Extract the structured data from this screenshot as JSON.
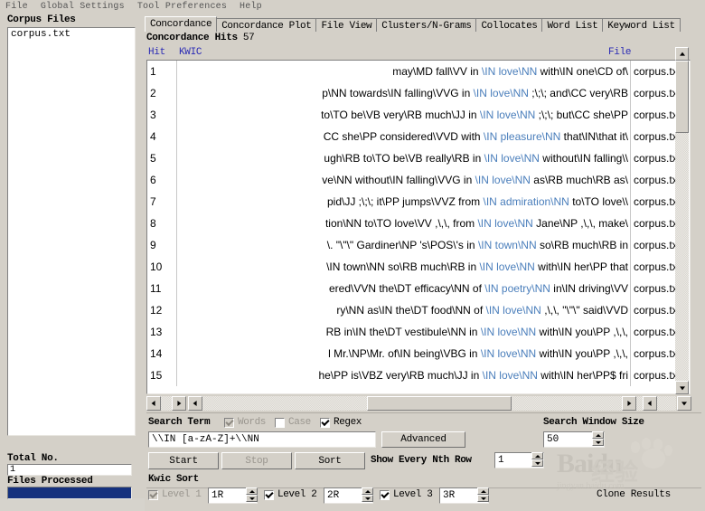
{
  "menubar": {
    "items": [
      {
        "label": "File"
      },
      {
        "label": "Global Settings"
      },
      {
        "label": "Tool Preferences"
      },
      {
        "label": "Help"
      }
    ]
  },
  "sidebar": {
    "corpus_files_label": "Corpus Files",
    "files": [
      "corpus.txt"
    ],
    "total_no_label": "Total No.",
    "total_no_value": "1",
    "files_processed_label": "Files Processed"
  },
  "tabs": [
    {
      "label": "Concordance",
      "active": true
    },
    {
      "label": "Concordance Plot",
      "active": false
    },
    {
      "label": "File View",
      "active": false
    },
    {
      "label": "Clusters/N-Grams",
      "active": false
    },
    {
      "label": "Collocates",
      "active": false
    },
    {
      "label": "Word List",
      "active": false
    },
    {
      "label": "Keyword List",
      "active": false
    }
  ],
  "results": {
    "hits_label": "Concordance Hits",
    "hits_count": "57",
    "columns": {
      "hit": "Hit",
      "kwic": "KWIC",
      "file": "File"
    },
    "rows": [
      {
        "n": "1",
        "left": "may\\MD fall\\VV in",
        "key": "\\IN love\\NN",
        "right": "with\\IN one\\CD of\\",
        "file": "corpus.txt"
      },
      {
        "n": "2",
        "left": "p\\NN towards\\IN falling\\VVG in",
        "key": "\\IN love\\NN",
        "right": ";\\;\\; and\\CC very\\RB",
        "file": "corpus.txt"
      },
      {
        "n": "3",
        "left": "to\\TO be\\VB very\\RB much\\JJ in",
        "key": "\\IN love\\NN",
        "right": ";\\;\\; but\\CC she\\PP ",
        "file": "corpus.txt"
      },
      {
        "n": "4",
        "left": "CC she\\PP considered\\VVD with",
        "key": "\\IN pleasure\\NN",
        "right": "that\\IN\\that it\\",
        "file": "corpus.txt"
      },
      {
        "n": "5",
        "left": "ugh\\RB to\\TO be\\VB really\\RB in",
        "key": "\\IN love\\NN",
        "right": "without\\IN falling\\\\",
        "file": "corpus.txt"
      },
      {
        "n": "6",
        "left": "ve\\NN without\\IN falling\\VVG in",
        "key": "\\IN love\\NN",
        "right": "as\\RB much\\RB as\\",
        "file": "corpus.txt"
      },
      {
        "n": "7",
        "left": "pid\\JJ ;\\;\\; it\\PP jumps\\VVZ from",
        "key": "\\IN admiration\\NN",
        "right": "to\\TO love\\\\",
        "file": "corpus.txt"
      },
      {
        "n": "8",
        "left": "tion\\NN to\\TO love\\VV ,\\,\\, from",
        "key": "\\IN love\\NN",
        "right": "Jane\\NP ,\\,\\, make\\",
        "file": "corpus.txt"
      },
      {
        "n": "9",
        "left": "\\. \"\\\"\\\" Gardiner\\NP 's\\POS\\'s in",
        "key": "\\IN town\\NN",
        "right": "so\\RB much\\RB in",
        "file": "corpus.txt"
      },
      {
        "n": "10",
        "left": "\\IN town\\NN so\\RB much\\RB in",
        "key": "\\IN love\\NN",
        "right": "with\\IN her\\PP that",
        "file": "corpus.txt"
      },
      {
        "n": "11",
        "left": "ered\\VVN the\\DT efficacy\\NN of",
        "key": "\\IN poetry\\NN",
        "right": "in\\IN driving\\VV",
        "file": "corpus.txt"
      },
      {
        "n": "12",
        "left": "ry\\NN as\\IN the\\DT food\\NN of",
        "key": "\\IN love\\NN",
        "right": ",\\,\\, \"\\\"\\\" said\\VVD ",
        "file": "corpus.txt"
      },
      {
        "n": "13",
        "left": "RB in\\IN the\\DT vestibule\\NN in",
        "key": "\\IN love\\NN",
        "right": "with\\IN you\\PP ,\\,\\,",
        "file": "corpus.txt"
      },
      {
        "n": "14",
        "left": "l Mr.\\NP\\Mr. of\\IN being\\VBG in",
        "key": "\\IN love\\NN",
        "right": "with\\IN you\\PP ,\\,\\,",
        "file": "corpus.txt"
      },
      {
        "n": "15",
        "left": "he\\PP is\\VBZ very\\RB much\\JJ in",
        "key": "\\IN love\\NN",
        "right": "with\\IN her\\PP$ fri",
        "file": "corpus.txt"
      }
    ]
  },
  "controls": {
    "search_term_label": "Search Term",
    "words_label": "Words",
    "words_checked": true,
    "words_enabled": false,
    "case_label": "Case",
    "case_checked": false,
    "regex_label": "Regex",
    "regex_checked": true,
    "search_term_value": "\\\\IN [a-zA-Z]+\\\\NN",
    "advanced_label": "Advanced",
    "start_label": "Start",
    "stop_label": "Stop",
    "sort_label": "Sort",
    "show_every_nth_label": "Show Every Nth Row",
    "show_every_nth_value": "1",
    "search_window_label": "Search Window Size",
    "search_window_value": "50",
    "kwic_sort_label": "Kwic Sort",
    "level1_label": "Level 1",
    "level1_value": "1R",
    "level1_checked": true,
    "level1_enabled": false,
    "level2_label": "Level 2",
    "level2_value": "2R",
    "level2_checked": true,
    "level3_label": "Level 3",
    "level3_value": "3R",
    "level3_checked": true,
    "clone_results_label": "Clone Results"
  },
  "watermark": {
    "brand": "Baidu",
    "cn": "经验",
    "sub": "jingyan.baidu.com"
  },
  "colors": {
    "face": "#d4d0c8",
    "keyword": "#4a7ebb",
    "header_text": "#2b2bb5",
    "progress": "#15317e"
  }
}
